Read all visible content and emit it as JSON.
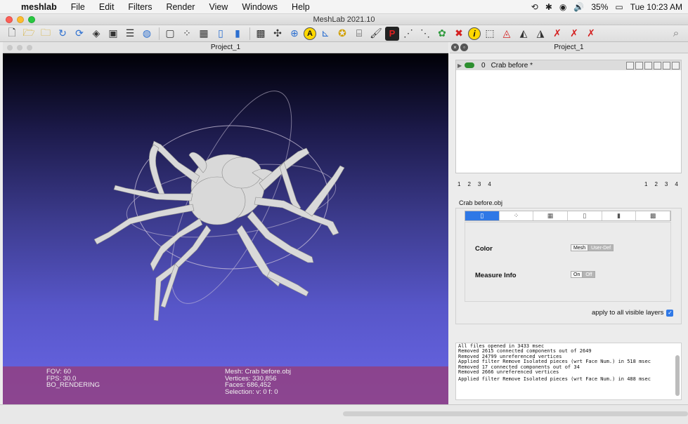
{
  "menubar": {
    "app": "meshlab",
    "items": [
      "File",
      "Edit",
      "Filters",
      "Render",
      "View",
      "Windows",
      "Help"
    ],
    "battery": "35%",
    "clock": "Tue 10:23 AM"
  },
  "window": {
    "title": "MeshLab 2021.10"
  },
  "viewport": {
    "title": "Project_1",
    "info_left": [
      "FOV: 60",
      "FPS:   30.0",
      "BO_RENDERING"
    ],
    "info_mid": [
      "Mesh: Crab before.obj",
      "Vertices: 330,856",
      "Faces: 686,452",
      "Selection: v: 0 f: 0"
    ]
  },
  "right_pane": {
    "title": "Project_1",
    "layer": {
      "index": "0",
      "name": "Crab before *"
    },
    "pager_left": [
      "1",
      "2",
      "3",
      "4"
    ],
    "pager_right": [
      "1",
      "2",
      "3",
      "4"
    ],
    "object_label": "Crab before.obj",
    "color_label": "Color",
    "color_options": [
      "Mesh",
      "User-Def"
    ],
    "measure_label": "Measure Info",
    "measure_options": [
      "On",
      "Off"
    ],
    "apply_label": "apply to all visible layers"
  },
  "log": {
    "lines": [
      "All files opened in 3433 msec",
      "Removed 2615 connected components out of 2649",
      "Removed 24799 unreferenced vertices",
      "Applied filter Remove Isolated pieces (wrt Face Num.) in 518 msec",
      "Removed 17 connected components out of 34",
      "Removed 2666 unreferenced vertices"
    ],
    "last_line": "Applied filter Remove Isolated pieces (wrt Face Num.) in 488 msec"
  },
  "toolbar_icons": [
    "new-icon",
    "open-icon",
    "open-project-icon",
    "reload-icon",
    "reload-all-icon",
    "import-icon",
    "snapshot-icon",
    "layers-icon",
    "globe-icon",
    "bbox-icon",
    "points-icon",
    "wireframe-icon",
    "flat-icon",
    "smooth-icon",
    "texture-icon",
    "axes-icon",
    "trackball-icon",
    "label-icon",
    "light-icon",
    "paint-icon",
    "align-icon",
    "pickpoints-icon",
    "select-icon",
    "georef-icon",
    "info-icon",
    "select-faces-icon",
    "delete-icon"
  ]
}
